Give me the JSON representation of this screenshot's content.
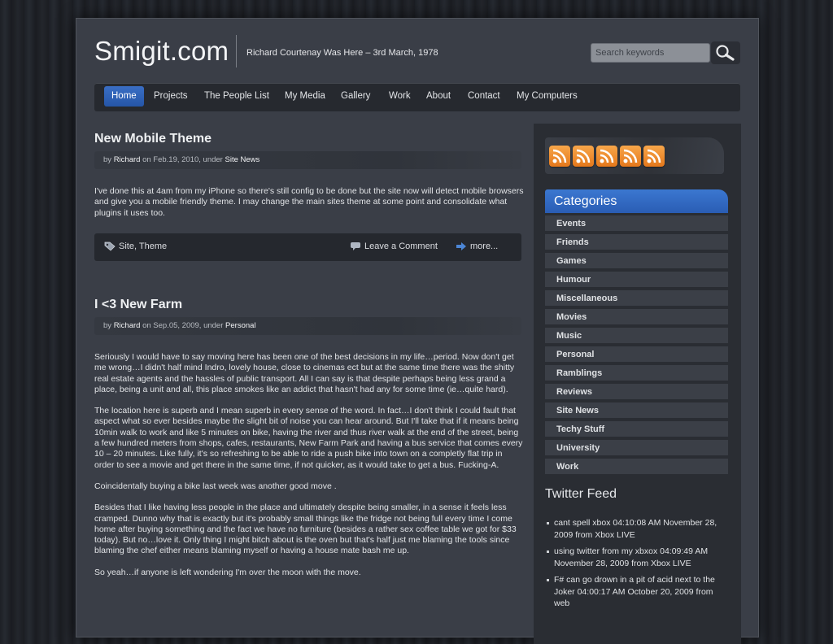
{
  "header": {
    "site_title": "Smigit.com",
    "tagline": "Richard Courtenay Was Here – 3rd March, 1978",
    "search_placeholder": "Search keywords"
  },
  "nav": {
    "items": [
      "Home",
      "Projects",
      "The People List",
      "My Media",
      "Gallery",
      "Work",
      "About",
      "Contact",
      "My Computers"
    ],
    "active": "Home"
  },
  "posts": [
    {
      "title": "New Mobile Theme",
      "meta": {
        "by": "by",
        "author": "Richard",
        "on": "on Feb.19, 2010, under",
        "category": "Site News"
      },
      "paragraphs": [
        "I've done this at 4am from my iPhone so there's still config to be done but the site now will detect mobile browsers and give you a mobile friendly theme. I may change the main sites theme at some point and consolidate what plugins it uses too."
      ],
      "footer": {
        "tags": "Site, Theme",
        "comment": "Leave a Comment",
        "more": "more..."
      }
    },
    {
      "title": "I <3 New Farm",
      "meta": {
        "by": "by",
        "author": "Richard",
        "on": "on Sep.05, 2009, under",
        "category": "Personal"
      },
      "paragraphs": [
        "Seriously I would have to say moving here has been one of the best decisions in my life…period. Now don't get me wrong…I didn't half mind Indro, lovely house, close to cinemas ect but at the same time there was the shitty real estate agents and the hassles of public transport. All I can say is that despite perhaps being less grand a place, being a unit and all, this place smokes like an addict that hasn't had any for some time (ie…quite hard).",
        "The location here is superb and I mean superb in every sense of the word. In fact…I don't think I could fault that aspect what so ever besides maybe the slight bit of noise you can hear around. But I'll take that if it means being 10min walk to work and like 5 minutes on bike, having the river and thus river walk at the end of the street, being a few hundred meters from shops, cafes, restaurants, New Farm Park and having a bus service that comes every 10 – 20 minutes. Like fully, it's so refreshing to be able to ride a push bike into town on a completly flat trip in order to see a movie and get there in the same time, if not quicker, as it would take to get a bus. Fucking-A.",
        "Coincidentally buying a bike last week was another good move .",
        "Besides that I like having less people in the place and ultimately despite being smaller, in a sense it feels less cramped. Dunno why that is exactly but it's probably small things like the fridge not being full every time I come home after buying something and the fact we have no furniture (besides a rather sex coffee table we got for $33 today). But no…love it. Only thing I might bitch about is the oven but that's half just me blaming the tools since blaming the chef either means blaming myself or having a house mate bash me up.",
        "So yeah…if anyone is left wondering I'm over the moon with the move."
      ]
    }
  ],
  "sidebar": {
    "categories_title": "Categories",
    "categories": [
      "Events",
      "Friends",
      "Games",
      "Humour",
      "Miscellaneous",
      "Movies",
      "Music",
      "Personal",
      "Ramblings",
      "Reviews",
      "Site News",
      "Techy Stuff",
      "University",
      "Work"
    ],
    "twitter_title": "Twitter Feed",
    "tweets": [
      "cant spell xbox 04:10:08 AM November 28, 2009 from Xbox LIVE",
      "using twitter from my xbxox 04:09:49 AM November 28, 2009 from Xbox LIVE",
      "F# can go drown in a pit of acid next to the Joker 04:00:17 AM October 20, 2009 from web"
    ]
  },
  "colors": {
    "accent": "#2f63bb",
    "rss": "#ee8a2a",
    "background": "#3a3e47"
  },
  "icons": [
    "search-icon",
    "rss-icon",
    "tag-icon",
    "comment-icon",
    "arrow-right-icon"
  ]
}
